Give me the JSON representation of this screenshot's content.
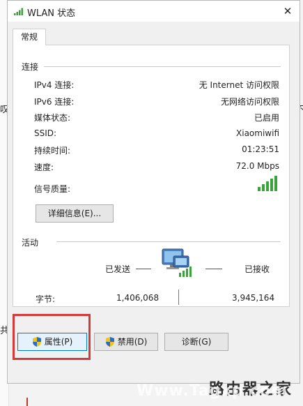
{
  "window": {
    "title": "WLAN 状态",
    "close_glyph": "✕"
  },
  "tabs": [
    {
      "label": "常规"
    }
  ],
  "connection": {
    "section_label": "连接",
    "rows": [
      {
        "label": "IPv4 连接:",
        "value": "无 Internet 访问权限"
      },
      {
        "label": "IPv6 连接:",
        "value": "无网络访问权限"
      },
      {
        "label": "媒体状态:",
        "value": "已启用"
      },
      {
        "label": "SSID:",
        "value": "Xiaomiwifi"
      },
      {
        "label": "持续时间:",
        "value": "01:23:51"
      },
      {
        "label": "速度:",
        "value": "72.0 Mbps"
      }
    ],
    "signal_label": "信号质量:",
    "signal_bars": 5,
    "details_button": "详细信息(E)..."
  },
  "activity": {
    "section_label": "活动",
    "sent_label": "已发送",
    "received_label": "已接收",
    "bytes_label": "字节:",
    "bytes_sent": "1,406,068",
    "bytes_received": "3,945,164"
  },
  "buttons": {
    "properties": "属性(P)",
    "disable": "禁用(D)",
    "diagnose": "诊断(G)"
  },
  "background_chars": {
    "left": "叹",
    "right": "不",
    "bottom_left": "共"
  },
  "watermark": {
    "site": "Www.Tagxp.com",
    "cn": "路由器之家"
  },
  "colors": {
    "highlight": "#d33a3a",
    "signal_green": "#3aa33a",
    "accent": "#0078d7"
  }
}
